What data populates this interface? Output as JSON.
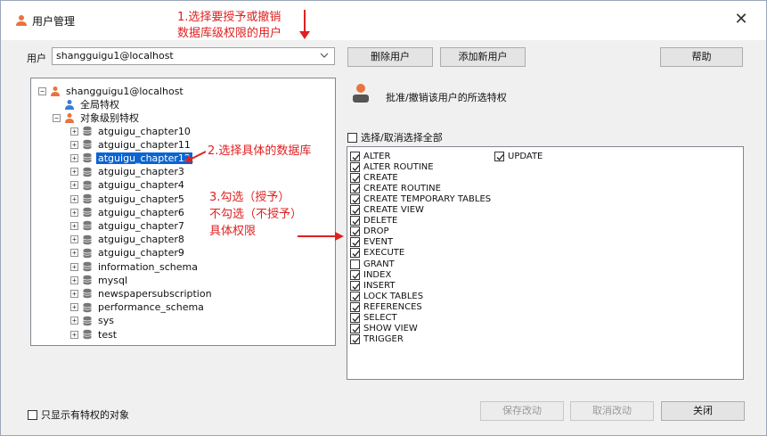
{
  "window": {
    "title": "用户管理",
    "close_symbol": "✕"
  },
  "annotations": {
    "step1_line1": "1.选择要授予或撤销",
    "step1_line2": "数据库级权限的用户",
    "step2": "2.选择具体的数据库",
    "step3_line1": "3.勾选（授予）",
    "step3_line2": "不勾选（不授予）",
    "step3_line3": "具体权限"
  },
  "user": {
    "label": "用户",
    "value": "shangguigu1@localhost"
  },
  "buttons": {
    "delete_user": "删除用户",
    "add_user": "添加新用户",
    "help": "帮助",
    "save": "保存改动",
    "cancel": "取消改动",
    "close": "关闭"
  },
  "tree": {
    "root": "shangguigu1@localhost",
    "global": "全局特权",
    "object_level": "对象级别特权",
    "databases": [
      "atguigu_chapter10",
      "atguigu_chapter11",
      "atguigu_chapter12",
      "atguigu_chapter3",
      "atguigu_chapter4",
      "atguigu_chapter5",
      "atguigu_chapter6",
      "atguigu_chapter7",
      "atguigu_chapter8",
      "atguigu_chapter9",
      "information_schema",
      "mysql",
      "newspapersubscription",
      "performance_schema",
      "sys",
      "test"
    ],
    "selected_database": "atguigu_chapter12"
  },
  "privileges": {
    "header": "批准/撤销该用户的所选特权",
    "select_all": "选择/取消选择全部",
    "items": [
      {
        "name": "ALTER",
        "checked": true
      },
      {
        "name": "ALTER ROUTINE",
        "checked": true
      },
      {
        "name": "CREATE",
        "checked": true
      },
      {
        "name": "CREATE ROUTINE",
        "checked": true
      },
      {
        "name": "CREATE TEMPORARY TABLES",
        "checked": true
      },
      {
        "name": "CREATE VIEW",
        "checked": true
      },
      {
        "name": "DELETE",
        "checked": true
      },
      {
        "name": "DROP",
        "checked": true
      },
      {
        "name": "EVENT",
        "checked": true
      },
      {
        "name": "EXECUTE",
        "checked": true
      },
      {
        "name": "GRANT",
        "checked": false
      },
      {
        "name": "INDEX",
        "checked": true
      },
      {
        "name": "INSERT",
        "checked": true
      },
      {
        "name": "LOCK TABLES",
        "checked": true
      },
      {
        "name": "REFERENCES",
        "checked": true
      },
      {
        "name": "SELECT",
        "checked": true
      },
      {
        "name": "SHOW VIEW",
        "checked": true
      },
      {
        "name": "TRIGGER",
        "checked": true
      },
      {
        "name": "UPDATE",
        "checked": true
      }
    ]
  },
  "filter": {
    "label": "只显示有特权的对象"
  },
  "colors": {
    "annotation": "#e02020",
    "selection": "#0a64d2",
    "user_icon": "#e8743c"
  },
  "icons": {
    "user": "user-icon",
    "database": "database-icon",
    "check": "check-icon"
  }
}
